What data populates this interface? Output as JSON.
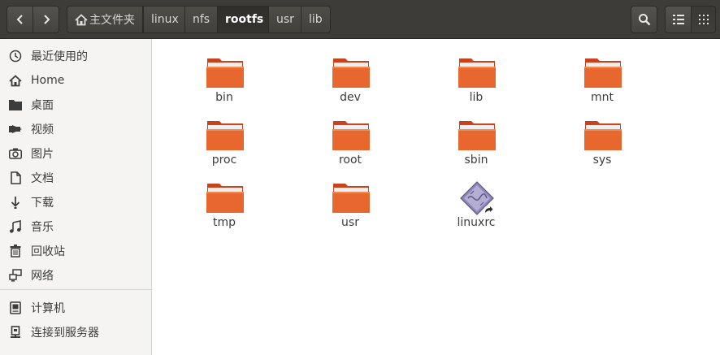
{
  "header": {
    "breadcrumbs": [
      {
        "label": "主文件夹",
        "icon": "home-icon"
      },
      {
        "label": "linux"
      },
      {
        "label": "nfs"
      },
      {
        "label": "rootfs",
        "active": true
      },
      {
        "label": "usr"
      },
      {
        "label": "lib"
      }
    ],
    "accent_color": "#e95420"
  },
  "sidebar": {
    "items": [
      {
        "label": "最近使用的",
        "icon": "clock-icon"
      },
      {
        "label": "Home",
        "icon": "home-icon"
      },
      {
        "label": "桌面",
        "icon": "desktop-folder-icon"
      },
      {
        "label": "视频",
        "icon": "video-icon"
      },
      {
        "label": "图片",
        "icon": "camera-icon"
      },
      {
        "label": "文档",
        "icon": "document-icon"
      },
      {
        "label": "下载",
        "icon": "download-icon"
      },
      {
        "label": "音乐",
        "icon": "music-icon"
      },
      {
        "label": "回收站",
        "icon": "trash-icon"
      },
      {
        "label": "网络",
        "icon": "network-icon"
      },
      {
        "label": "计算机",
        "icon": "computer-icon"
      },
      {
        "label": "连接到服务器",
        "icon": "server-icon"
      }
    ]
  },
  "files": [
    {
      "name": "bin",
      "type": "folder"
    },
    {
      "name": "dev",
      "type": "folder"
    },
    {
      "name": "lib",
      "type": "folder"
    },
    {
      "name": "mnt",
      "type": "folder"
    },
    {
      "name": "proc",
      "type": "folder"
    },
    {
      "name": "root",
      "type": "folder"
    },
    {
      "name": "sbin",
      "type": "folder"
    },
    {
      "name": "sys",
      "type": "folder"
    },
    {
      "name": "tmp",
      "type": "folder"
    },
    {
      "name": "usr",
      "type": "folder"
    },
    {
      "name": "linuxrc",
      "type": "symlink-executable"
    }
  ]
}
